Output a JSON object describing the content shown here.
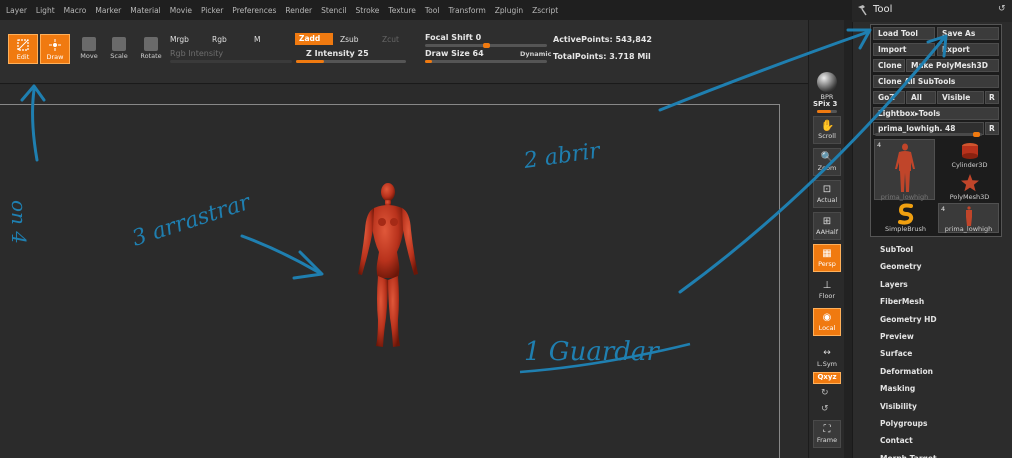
{
  "menu": [
    "Layer",
    "Light",
    "Macro",
    "Marker",
    "Material",
    "Movie",
    "Picker",
    "Preferences",
    "Render",
    "Stencil",
    "Stroke",
    "Texture",
    "Tool",
    "Transform",
    "Zplugin",
    "Zscript"
  ],
  "toolbar": {
    "edit": "Edit",
    "draw": "Draw",
    "move": "Move",
    "scale": "Scale",
    "rotate": "Rotate",
    "mrgb": "Mrgb",
    "rgb": "Rgb",
    "m": "M",
    "rgb_intensity": "Rgb Intensity",
    "zadd": "Zadd",
    "zsub": "Zsub",
    "zcut": "Zcut",
    "z_intensity_label": "Z Intensity",
    "z_intensity_value": "25",
    "z_intensity": 0.25,
    "focal_shift_label": "Focal Shift",
    "focal_shift_value": "0",
    "focal_shift": 0.5,
    "draw_size_label": "Draw Size",
    "draw_size_value": "64",
    "draw_size": 0.06,
    "dynamic": "Dynamic",
    "active_points_label": "ActivePoints:",
    "active_points_value": "543,842",
    "total_points_label": "TotalPoints:",
    "total_points_value": "3.718 Mil"
  },
  "shelf": {
    "bpr": "BPR",
    "spix_label": "SPix",
    "spix_value": "3",
    "scroll": "Scroll",
    "zoom": "Zoom",
    "actual": "Actual",
    "aahalf": "AAHalf",
    "persp": "Persp",
    "floor": "Floor",
    "local": "Local",
    "lsym": "L.Sym",
    "xyz": "Qxyz",
    "frame": "Frame"
  },
  "palette": {
    "title": "Tool",
    "load_tool": "Load Tool",
    "save_as": "Save As",
    "import": "Import",
    "export": "Export",
    "clone": "Clone",
    "make_polymesh": "Make PolyMesh3D",
    "clone_all": "Clone All SubTools",
    "goz": "GoZ",
    "all": "All",
    "visible": "Visible",
    "r": "R",
    "lightbox": "Lightbox▸Tools",
    "current_tool": "prima_lowhigh. 48",
    "thumb_count_1": "4",
    "thumb_name_1": "prima_lowhigh",
    "cylinder": "Cylinder3D",
    "polymesh": "PolyMesh3D",
    "simplebrush": "SimpleBrush",
    "thumb_count_2": "4",
    "thumb_name_2": "prima_lowhigh",
    "sections": [
      "SubTool",
      "Geometry",
      "Layers",
      "FiberMesh",
      "Geometry HD",
      "Preview",
      "Surface",
      "Deformation",
      "Masking",
      "Visibility",
      "Polygroups",
      "Contact",
      "Morph Target"
    ]
  },
  "annotations": {
    "a1": "1 Guardar",
    "a2": "2 abrir",
    "a3": "3 arrastrar",
    "a4": "on 4"
  },
  "colors": {
    "accent": "#f07a10",
    "ink": "#1f7fb0",
    "figure": "#b8321c"
  }
}
